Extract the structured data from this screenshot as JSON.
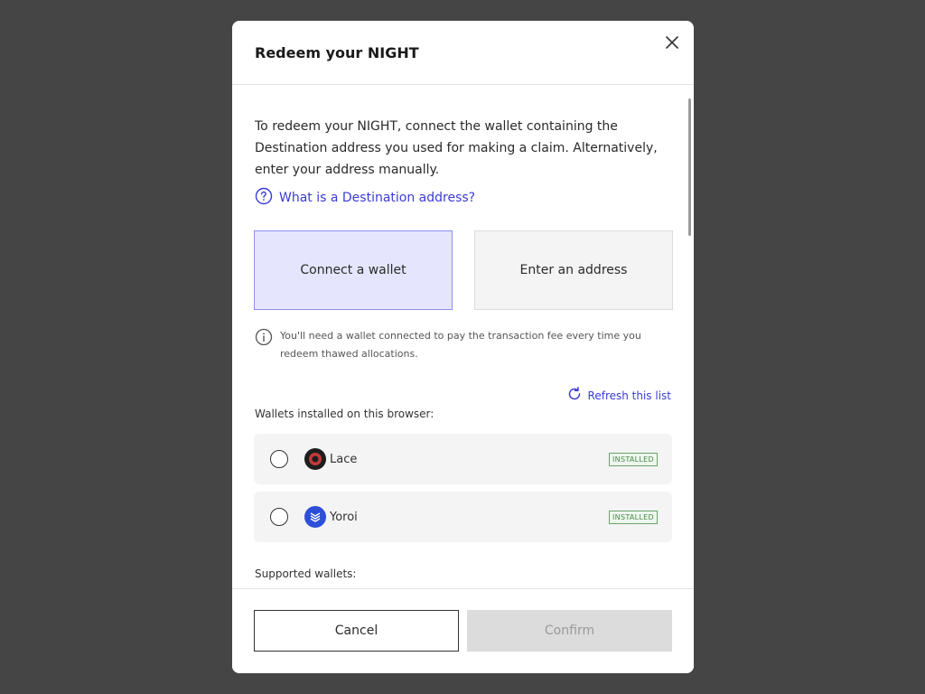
{
  "modal": {
    "title": "Redeem your NIGHT",
    "close_icon": "close-icon"
  },
  "intro": {
    "text": "To redeem your NIGHT, connect the wallet containing the Destination address you used for making a claim. Alternatively, enter your address manually.",
    "help_link": "What is a Destination address?",
    "help_icon": "question-circle-icon"
  },
  "options": {
    "connect_wallet": "Connect a wallet",
    "enter_address": "Enter an address",
    "selected": "Connect a wallet"
  },
  "notice": {
    "icon": "info-circle-icon",
    "text": "You'll need a wallet connected to pay the transaction fee every time you redeem thawed allocations."
  },
  "installed": {
    "label": "Wallets installed on this browser:",
    "refresh_label": "Refresh this list",
    "refresh_icon": "refresh-icon",
    "wallets": [
      {
        "name": "Lace",
        "badge": "INSTALLED",
        "logo": "lace-logo",
        "color": "#c23a3a"
      },
      {
        "name": "Yoroi",
        "badge": "INSTALLED",
        "logo": "yoroi-logo",
        "color": "#2d4fd8"
      }
    ]
  },
  "supported": {
    "label": "Supported wallets:"
  },
  "footer": {
    "cancel_label": "Cancel",
    "confirm_label": "Confirm"
  },
  "colors": {
    "accent": "#3b3bd6",
    "selected_card_bg": "#e5e6fd",
    "backdrop": "#454545"
  }
}
